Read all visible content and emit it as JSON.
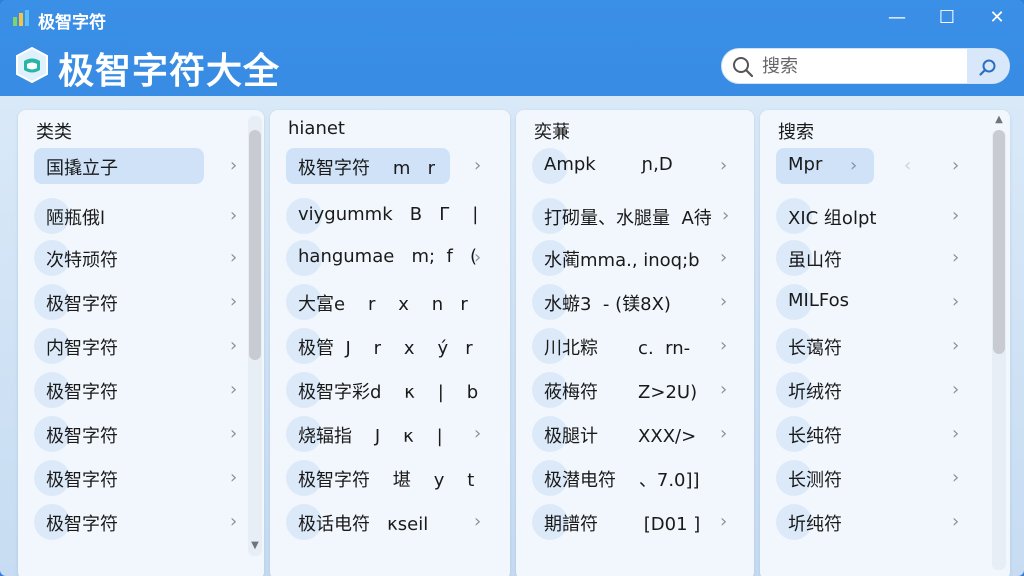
{
  "window": {
    "title": "极智字符",
    "min_label": "—",
    "max_label": "☐",
    "close_label": "✕"
  },
  "header": {
    "title": "极智字符大全"
  },
  "search": {
    "placeholder": "搜索"
  },
  "panels": [
    {
      "heading": "类类",
      "rows": [
        "国撬立子",
        "陋瓶俄l",
        "次特顽符",
        "极智字符",
        "内智字符",
        "极智字符",
        "极智字符",
        "极智字符",
        "极智字符"
      ]
    },
    {
      "heading": "hianet",
      "rows": [
        "极智字符    m   r",
        "viygummk   B   Γ    |",
        "hangumae   m;  f   (",
        "大富e    r    x    n   r",
        "极管  J    r    x    ý   r",
        "极智字彩d    κ    |    b",
        "烧辐指    J    κ    |",
        "极智字符    堪    y    t",
        "极话电符   κseil"
      ]
    },
    {
      "heading": "奕蒹",
      "rows": [
        "Ampk        ɲ,D",
        "打砌量、水腿量  A待",
        "水蔺mma., inoq;b",
        "水蝣3  - (镁8X)",
        "川北粽       c.  rn-",
        "莜梅符       Z>2U)",
        "极腿计       XXX/>",
        "极潜电符    、7.0]]",
        "期譜符        [D01 ]"
      ]
    },
    {
      "heading": "搜索",
      "rows": [
        "Mpr",
        "XIC 组olpt",
        "虽山符",
        "MILFos",
        "长蔼符",
        "圻绒符",
        "长纯符",
        "长测符",
        "圻纯符"
      ]
    }
  ]
}
